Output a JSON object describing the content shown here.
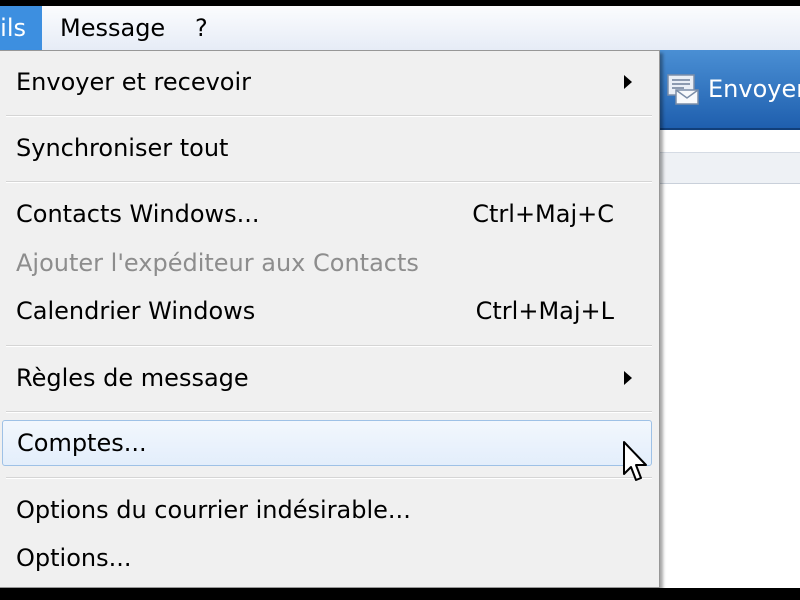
{
  "menubar": {
    "items": [
      {
        "label": "ils"
      },
      {
        "label": "Message"
      },
      {
        "label": "?"
      }
    ]
  },
  "toolbar": {
    "send_label": "Envoyer"
  },
  "dropdown": {
    "send_receive": {
      "label": "Envoyer et recevoir"
    },
    "sync_all": {
      "label": "Synchroniser tout"
    },
    "contacts": {
      "label": "Contacts Windows...",
      "shortcut": "Ctrl+Maj+C"
    },
    "add_sender": {
      "label": "Ajouter l'expéditeur aux Contacts"
    },
    "calendar": {
      "label": "Calendrier Windows",
      "shortcut": "Ctrl+Maj+L"
    },
    "rules": {
      "label": "Règles de message"
    },
    "accounts": {
      "label": "Comptes..."
    },
    "junk": {
      "label": "Options du courrier indésirable..."
    },
    "options": {
      "label": "Options..."
    }
  },
  "colors": {
    "menu_active": "#3d8fe0",
    "toolbar_blue": "#1f5fae",
    "hover_border": "#9ec1e6",
    "disabled_text": "#8d8d8d"
  },
  "icons": [
    "send-receive-icon",
    "submenu-arrow-icon",
    "mouse-cursor-icon"
  ]
}
